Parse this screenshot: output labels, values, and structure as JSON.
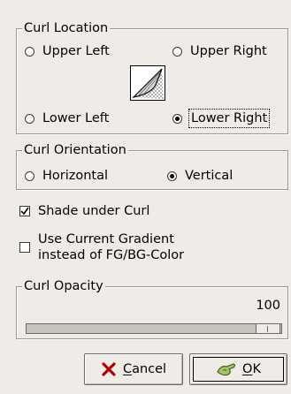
{
  "curl_location": {
    "title": "Curl Location",
    "options": {
      "upper_left": "Upper Left",
      "upper_right": "Upper Right",
      "lower_left": "Lower Left",
      "lower_right": "Lower Right"
    },
    "selected": "lower_right"
  },
  "curl_orientation": {
    "title": "Curl Orientation",
    "options": {
      "horizontal": "Horizontal",
      "vertical": "Vertical"
    },
    "selected": "vertical"
  },
  "shade_under_curl": {
    "label": "Shade under Curl",
    "checked": true
  },
  "use_gradient": {
    "label_line1": "Use Current Gradient",
    "label_line2": "instead of FG/BG-Color",
    "checked": false
  },
  "curl_opacity": {
    "title": "Curl Opacity",
    "value": "100",
    "fraction": 1.0
  },
  "buttons": {
    "cancel_prefix": "",
    "cancel_ul": "C",
    "cancel_rest": "ancel",
    "ok_ul": "O",
    "ok_rest": "K"
  },
  "colors": {
    "background": "#efebe7",
    "trough": "#c9c3bd",
    "cancel_icon": "#cc0000",
    "ok_icon": "#6a8a3a"
  }
}
